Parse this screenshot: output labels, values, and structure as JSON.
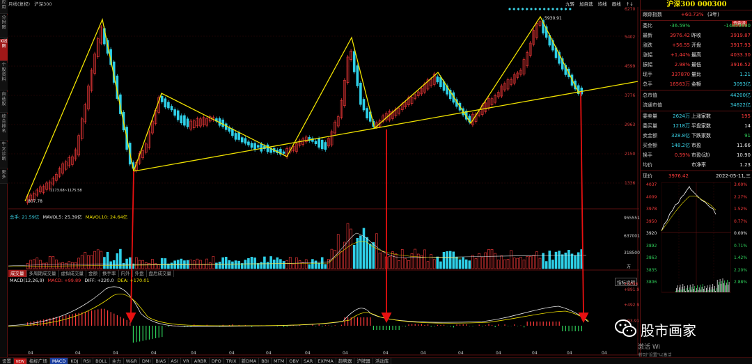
{
  "left_tabs": [
    "应用",
    "分时图",
    "K线图",
    "个股资料",
    "自选股",
    "综合排名",
    "牛叉诊断",
    "更多"
  ],
  "top_bar": {
    "period": "月线(复权)",
    "name": "沪深300",
    "tools": [
      "九转",
      "加自选",
      "均线",
      "画线",
      "↑↓"
    ]
  },
  "price_axis": [
    "6270",
    "5402",
    "4599",
    "3776",
    "2963",
    "2150",
    "1336"
  ],
  "annotations": {
    "high": "5930.91",
    "low": "807.78",
    "mid_low": "1173.68~1175.58"
  },
  "volume_legend": {
    "total": "总手: 21.59亿",
    "ma5": "MAVOL5: 25.39亿",
    "ma10": "MAVOL10: 24.64亿"
  },
  "volume_axis": [
    "955551",
    "637001",
    "318500",
    "万"
  ],
  "sub_tabs": [
    "成交量",
    "多周期成交量",
    "虚拟成交量",
    "金额",
    "换手率",
    "内外",
    "外盘",
    "盘后成交量"
  ],
  "macd_legend": {
    "label": "MACD(12,26,9)",
    "macd": "MACD: +99.89",
    "diff": "DIFF: +220.0",
    "dea": "DEA: +170.01",
    "hint": "指标说明"
  },
  "macd_axis": [
    "+1096",
    "+891.9",
    "+492.9",
    "+93.91"
  ],
  "x_axis_label": "04",
  "bottom_tabs": [
    "设置",
    "NEW",
    "指标广场",
    "MACD",
    "KDJ",
    "RSI",
    "BOLL",
    "主力",
    "W&R",
    "DMI",
    "BIAS",
    "ASI",
    "VR",
    "ARBR",
    "DPO",
    "TRIX",
    "新DMA",
    "BBI",
    "MTM",
    "OBV",
    "SAR",
    "EXPMA",
    "趋势器",
    "沪牌器",
    "活动库"
  ],
  "panel": {
    "title": "沪深300 000300",
    "badge": "去委派",
    "rows": [
      {
        "l": "跟踪指数",
        "v": "+60.73%",
        "v2": "(3年)"
      },
      {
        "l": "委比",
        "v": "-36.59%",
        "l2": "",
        "v3": "-14859890"
      },
      {
        "l": "最新",
        "v": "3976.42",
        "l2": "昨收",
        "v3": "3919.87"
      },
      {
        "l": "涨跌",
        "v": "+56.55",
        "l2": "开盘",
        "v3": "3917.93"
      },
      {
        "l": "涨幅",
        "v": "+1.44%",
        "l2": "最高",
        "v3": "4033.30"
      },
      {
        "l": "振幅",
        "v": "2.98%",
        "l2": "最低",
        "v3": "3916.52"
      },
      {
        "l": "现手",
        "v": "337870",
        "l2": "量比",
        "v3": "1.21"
      },
      {
        "l": "总手",
        "v": "16563万",
        "l2": "金额",
        "v3": "3093亿"
      }
    ],
    "market": [
      {
        "l": "总市值",
        "v": "44200亿"
      },
      {
        "l": "流通市值",
        "v": "34622亿"
      }
    ],
    "stats": [
      {
        "l": "委卖量",
        "v": "2624万",
        "l2": "上涨家数",
        "v3": "195"
      },
      {
        "l": "委买量",
        "v": "1218万",
        "l2": "平盘家数",
        "v3": "14"
      },
      {
        "l": "卖金额",
        "v": "328.8亿",
        "l2": "下跌家数",
        "v3": "91"
      },
      {
        "l": "买金额",
        "v": "148.2亿",
        "l2": "市盈",
        "v3": "11.66"
      },
      {
        "l": "换手",
        "v": "0.59%",
        "l2": "市盈(动)",
        "v3": "10.90"
      },
      {
        "l": "均价",
        "v": "",
        "l2": "市净率",
        "v3": "1.23"
      }
    ],
    "mini": {
      "price_label": "现价",
      "price": "3976.42",
      "date": "2022-05-11,三",
      "left_axis": [
        "4037",
        "4009",
        "3978",
        "3950",
        "3920",
        "3892",
        "3863",
        "3835",
        "3806"
      ],
      "right_axis": [
        "3.00%",
        "2.27%",
        "1.52%",
        "0.77%",
        "0.00%",
        "0.71%",
        "1.42%",
        "2.20%",
        "2.88%"
      ]
    }
  },
  "watermark": {
    "brand": "股市画家",
    "sub": "激活 Wi",
    "sub2": "转到\"设置\"以激活"
  },
  "colors": {
    "up": "#ff3b3b",
    "down": "#2fd0e8",
    "trendline": "#f0e200",
    "arrow": "#e81010"
  }
}
